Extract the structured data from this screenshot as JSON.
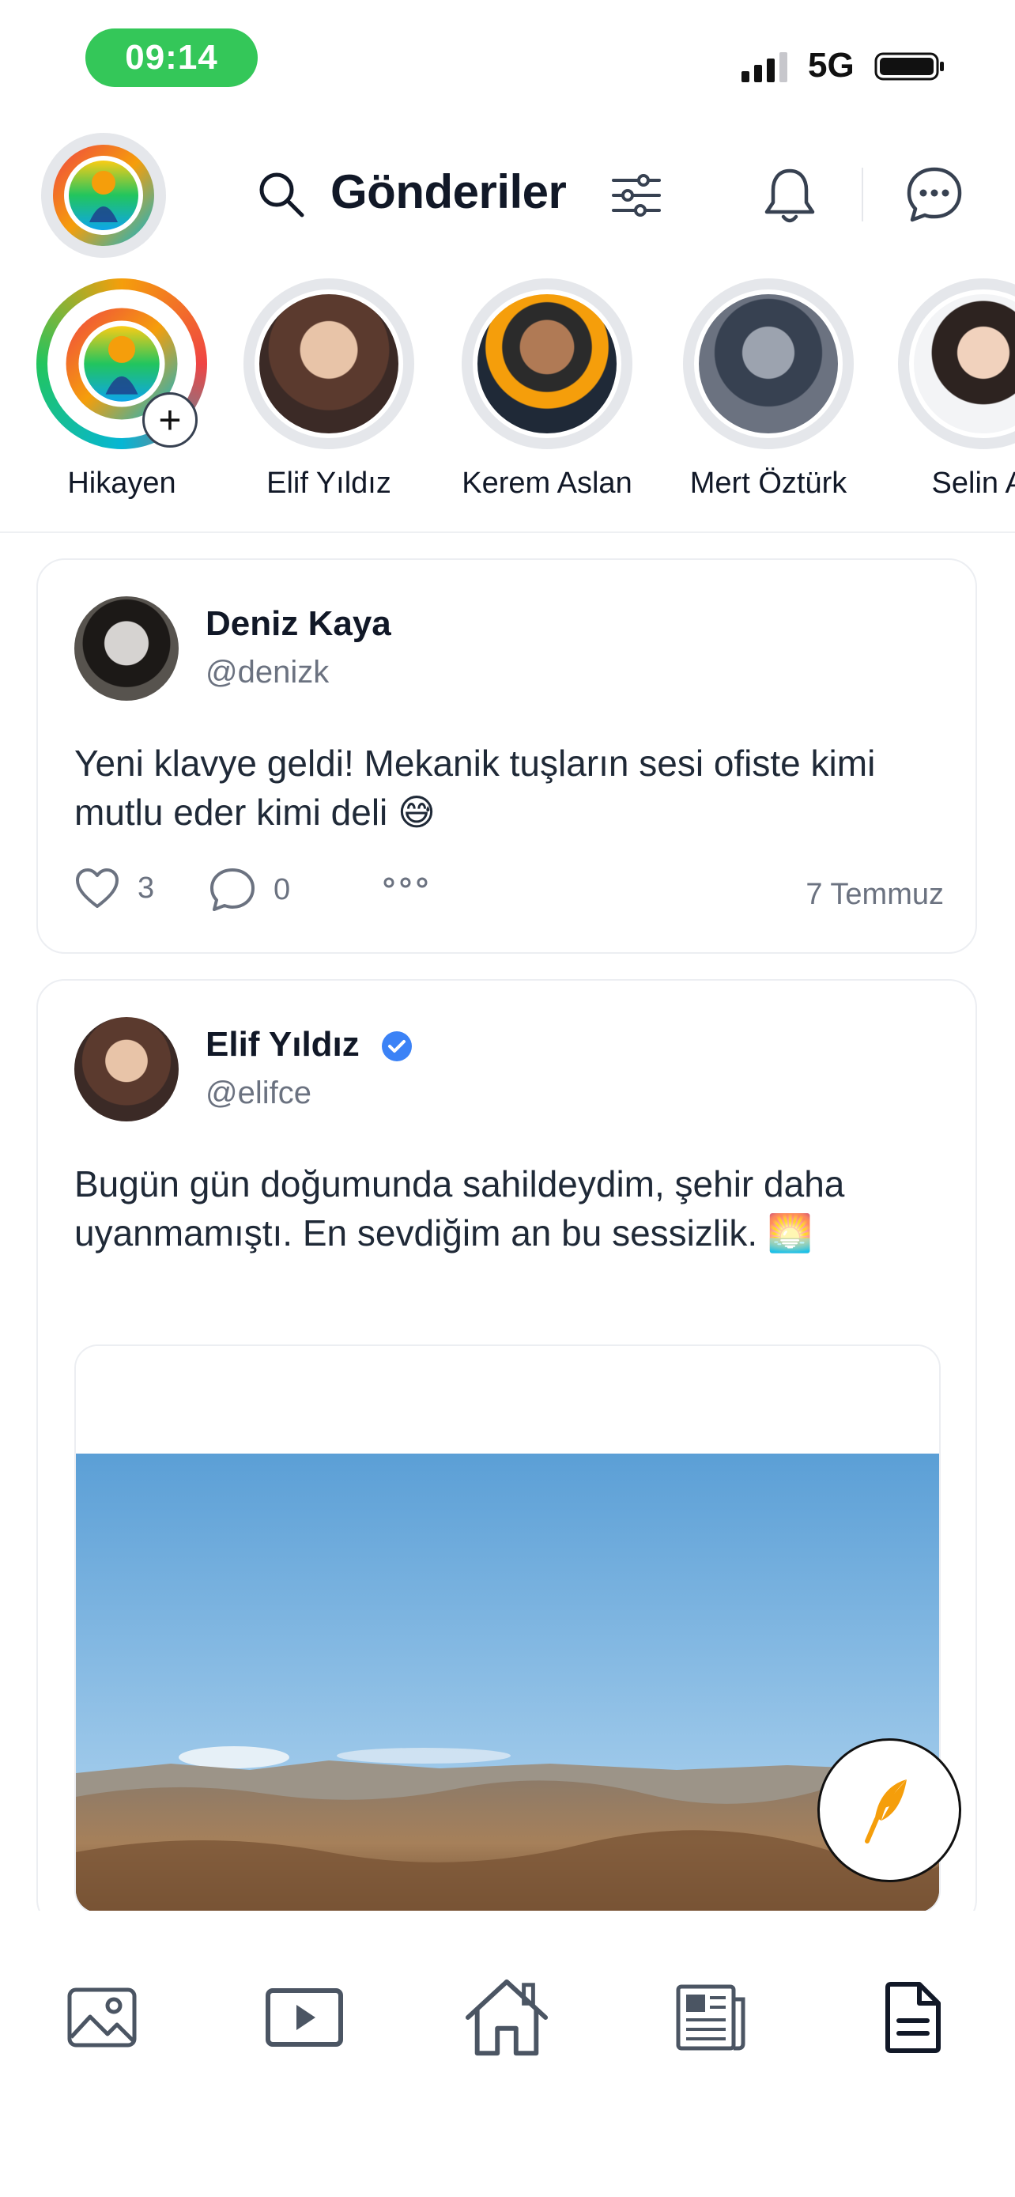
{
  "status_bar": {
    "time": "09:14",
    "network": "5G"
  },
  "header": {
    "title": "Gönderiler"
  },
  "stories": [
    {
      "name": "Hikayen",
      "own": true
    },
    {
      "name": "Elif Yıldız"
    },
    {
      "name": "Kerem Aslan"
    },
    {
      "name": "Mert Öztürk"
    },
    {
      "name": "Selin Ar"
    }
  ],
  "posts": [
    {
      "author": "Deniz Kaya",
      "handle": "@denizk",
      "text": "Yeni klavye geldi! Mekanik tuşların sesi ofiste kimi mutlu eder kimi deli 😅",
      "likes": "3",
      "comments": "0",
      "date": "7 Temmuz"
    },
    {
      "author": "Elif Yıldız",
      "handle": "@elifce",
      "verified": true,
      "text": "Bugün gün doğumunda sahildeydim, şehir daha uyanmamıştı. En sevdiğim an bu sessizlik. 🌅"
    }
  ],
  "icons": {
    "search": "search-icon",
    "filter": "sliders-icon",
    "notifications": "bell-icon",
    "messages": "chat-bubble-icon",
    "like": "heart-icon",
    "comment": "comment-icon",
    "more": "more-icon",
    "compose": "feather-icon",
    "tabs": [
      "image-icon",
      "video-icon",
      "home-icon",
      "news-icon",
      "document-icon"
    ]
  },
  "colors": {
    "accent": "#f59e0b",
    "time_pill": "#34c759",
    "verified": "#3b82f6"
  }
}
